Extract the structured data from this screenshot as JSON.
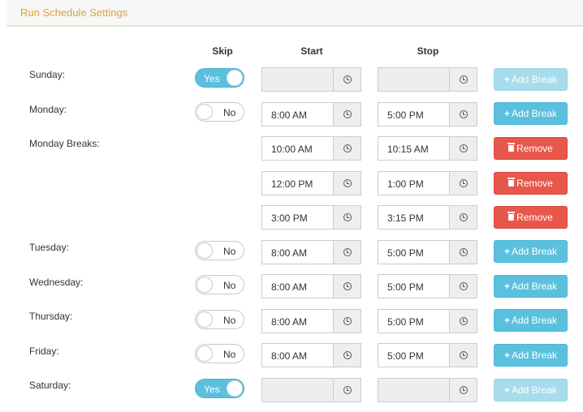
{
  "panel": {
    "title": "Run Schedule Settings"
  },
  "columns": {
    "skip": "Skip",
    "start": "Start",
    "stop": "Stop"
  },
  "labels": {
    "yes": "Yes",
    "no": "No",
    "add_break": "Add Break",
    "remove": "Remove",
    "plus_icon": "+"
  },
  "days": [
    {
      "label": "Sunday:",
      "skip": true,
      "start": "",
      "stop": ""
    },
    {
      "label": "Monday:",
      "skip": false,
      "start": "8:00 AM",
      "stop": "5:00 PM"
    },
    {
      "label": "Tuesday:",
      "skip": false,
      "start": "8:00 AM",
      "stop": "5:00 PM"
    },
    {
      "label": "Wednesday:",
      "skip": false,
      "start": "8:00 AM",
      "stop": "5:00 PM"
    },
    {
      "label": "Thursday:",
      "skip": false,
      "start": "8:00 AM",
      "stop": "5:00 PM"
    },
    {
      "label": "Friday:",
      "skip": false,
      "start": "8:00 AM",
      "stop": "5:00 PM"
    },
    {
      "label": "Saturday:",
      "skip": true,
      "start": "",
      "stop": ""
    }
  ],
  "monday_breaks": {
    "label": "Monday Breaks:",
    "items": [
      {
        "start": "10:00 AM",
        "stop": "10:15 AM"
      },
      {
        "start": "12:00 PM",
        "stop": "1:00 PM"
      },
      {
        "start": "3:00 PM",
        "stop": "3:15 PM"
      }
    ]
  },
  "colors": {
    "accent_title": "#e0a035",
    "info": "#5bc0de",
    "danger": "#e8574b"
  },
  "icons": {
    "time": "clock-icon",
    "add": "plus-icon",
    "remove": "trash-icon"
  }
}
